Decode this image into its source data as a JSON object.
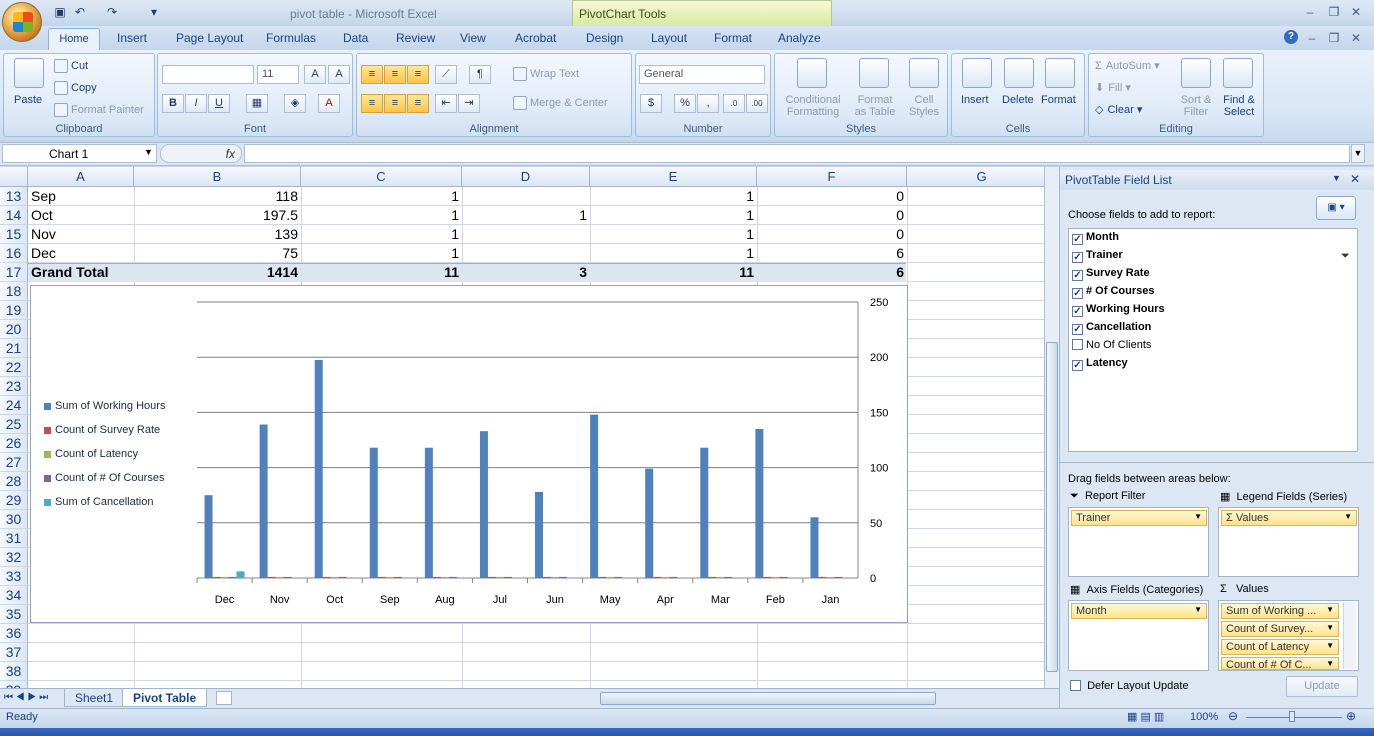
{
  "window": {
    "title": "pivot table - Microsoft Excel",
    "context_tab": "PivotChart Tools"
  },
  "tabs": [
    "Home",
    "Insert",
    "Page Layout",
    "Formulas",
    "Data",
    "Review",
    "View",
    "Acrobat",
    "Design",
    "Layout",
    "Format",
    "Analyze"
  ],
  "ribbon": {
    "clipboard": {
      "label": "Clipboard",
      "paste": "Paste",
      "cut": "Cut",
      "copy": "Copy",
      "format_painter": "Format Painter"
    },
    "font": {
      "label": "Font",
      "size": "11"
    },
    "alignment": {
      "label": "Alignment",
      "wrap_text": "Wrap Text",
      "merge_center": "Merge & Center"
    },
    "number": {
      "label": "Number",
      "format": "General"
    },
    "styles": {
      "label": "Styles",
      "conditional": "Conditional",
      "formatting": "Formatting",
      "format": "Format",
      "as_table": "as Table",
      "cell": "Cell",
      "styles": "Styles"
    },
    "cells": {
      "label": "Cells",
      "insert": "Insert",
      "delete": "Delete",
      "format": "Format"
    },
    "editing": {
      "label": "Editing",
      "autosum": "AutoSum",
      "fill": "Fill",
      "clear": "Clear",
      "sort": "Sort &",
      "filter": "Filter",
      "find": "Find &",
      "select": "Select"
    }
  },
  "formula_bar": {
    "name_box": "Chart 1",
    "fx": "fx"
  },
  "columns": [
    "A",
    "B",
    "C",
    "D",
    "E",
    "F",
    "G"
  ],
  "row_numbers": [
    "13",
    "14",
    "15",
    "16",
    "17",
    "18",
    "19",
    "20",
    "21",
    "22",
    "23",
    "24",
    "25",
    "26",
    "27",
    "28",
    "29",
    "30",
    "31",
    "32",
    "33",
    "34",
    "35",
    "36",
    "37",
    "38",
    "39"
  ],
  "rows": [
    {
      "A": "Sep",
      "B": "118",
      "C": "1",
      "D": "",
      "E": "1",
      "F": "0"
    },
    {
      "A": "Oct",
      "B": "197.5",
      "C": "1",
      "D": "1",
      "E": "1",
      "F": "0"
    },
    {
      "A": "Nov",
      "B": "139",
      "C": "1",
      "D": "",
      "E": "1",
      "F": "0"
    },
    {
      "A": "Dec",
      "B": "75",
      "C": "1",
      "D": "",
      "E": "1",
      "F": "6"
    }
  ],
  "grand_total": {
    "A": "Grand Total",
    "B": "1414",
    "C": "11",
    "D": "3",
    "E": "11",
    "F": "6"
  },
  "chart_data": {
    "type": "bar",
    "categories": [
      "Dec",
      "Nov",
      "Oct",
      "Sep",
      "Aug",
      "Jul",
      "Jun",
      "May",
      "Apr",
      "Mar",
      "Feb",
      "Jan"
    ],
    "series": [
      {
        "name": "Sum of Working Hours",
        "color": "#4f81bd",
        "values": [
          75,
          139,
          197.5,
          118,
          118,
          133,
          78,
          148,
          99,
          118,
          135,
          55
        ]
      },
      {
        "name": "Count of Survey Rate",
        "color": "#c0504d",
        "values": [
          1,
          1,
          1,
          1,
          1,
          1,
          1,
          1,
          1,
          1,
          1,
          1
        ]
      },
      {
        "name": "Count of Latency",
        "color": "#9bbb59",
        "values": [
          1,
          1,
          1,
          1,
          1,
          1,
          1,
          1,
          1,
          1,
          1,
          1
        ]
      },
      {
        "name": "Count of # Of Courses",
        "color": "#8064a2",
        "values": [
          1,
          1,
          1,
          1,
          1,
          1,
          1,
          1,
          1,
          1,
          1,
          1
        ]
      },
      {
        "name": "Sum of Cancellation",
        "color": "#4bacc6",
        "values": [
          6,
          0,
          0,
          0,
          0,
          0,
          0,
          0,
          0,
          0,
          0,
          0
        ]
      }
    ],
    "y_ticks": [
      "0",
      "50",
      "100",
      "150",
      "200",
      "250"
    ],
    "ylim": [
      0,
      250
    ],
    "legend": "left",
    "grid": true
  },
  "sheet_tabs": {
    "sheet1": "Sheet1",
    "pivot": "Pivot Table"
  },
  "status": {
    "ready": "Ready",
    "zoom": "100%"
  },
  "field_list": {
    "title": "PivotTable Field List",
    "choose": "Choose fields to add to report:",
    "fields": [
      {
        "name": "Month",
        "checked": true
      },
      {
        "name": "Trainer",
        "checked": true
      },
      {
        "name": "Survey Rate",
        "checked": true
      },
      {
        "name": "# Of Courses",
        "checked": true
      },
      {
        "name": "Working Hours",
        "checked": true
      },
      {
        "name": "Cancellation",
        "checked": true
      },
      {
        "name": "No Of Clients",
        "checked": false
      },
      {
        "name": "Latency",
        "checked": true
      }
    ],
    "drag_label": "Drag fields between areas below:",
    "report_filter": "Report Filter",
    "legend_fields": "Legend Fields (Series)",
    "axis_fields": "Axis Fields (Categories)",
    "values": "Values",
    "filter_pill": "Trainer",
    "legend_pill": "Values",
    "axis_pill": "Month",
    "value_pills": [
      "Sum of Working ...",
      "Count of Survey...",
      "Count of Latency",
      "Count of # Of C..."
    ],
    "defer": "Defer Layout Update",
    "update": "Update"
  }
}
